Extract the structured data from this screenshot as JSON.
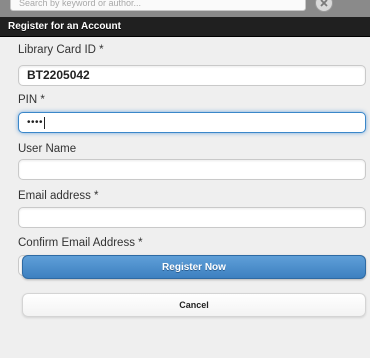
{
  "search": {
    "placeholder_text": "Search by keyword or author...",
    "clear_icon": "close-circle-icon"
  },
  "header": {
    "title": "Register for an Account"
  },
  "form": {
    "library_card": {
      "label": "Library Card ID *",
      "value": "BT2205042"
    },
    "pin": {
      "label": "PIN *",
      "value": "••••"
    },
    "username": {
      "label": "User Name",
      "value": ""
    },
    "email": {
      "label": "Email address *",
      "value": ""
    },
    "confirm_email": {
      "label": "Confirm Email Address *",
      "value": ""
    }
  },
  "buttons": {
    "register": "Register Now",
    "cancel": "Cancel"
  },
  "colors": {
    "header_bg": "#202020",
    "primary_button": "#4a8cca",
    "focus_ring": "#3a87c9"
  }
}
